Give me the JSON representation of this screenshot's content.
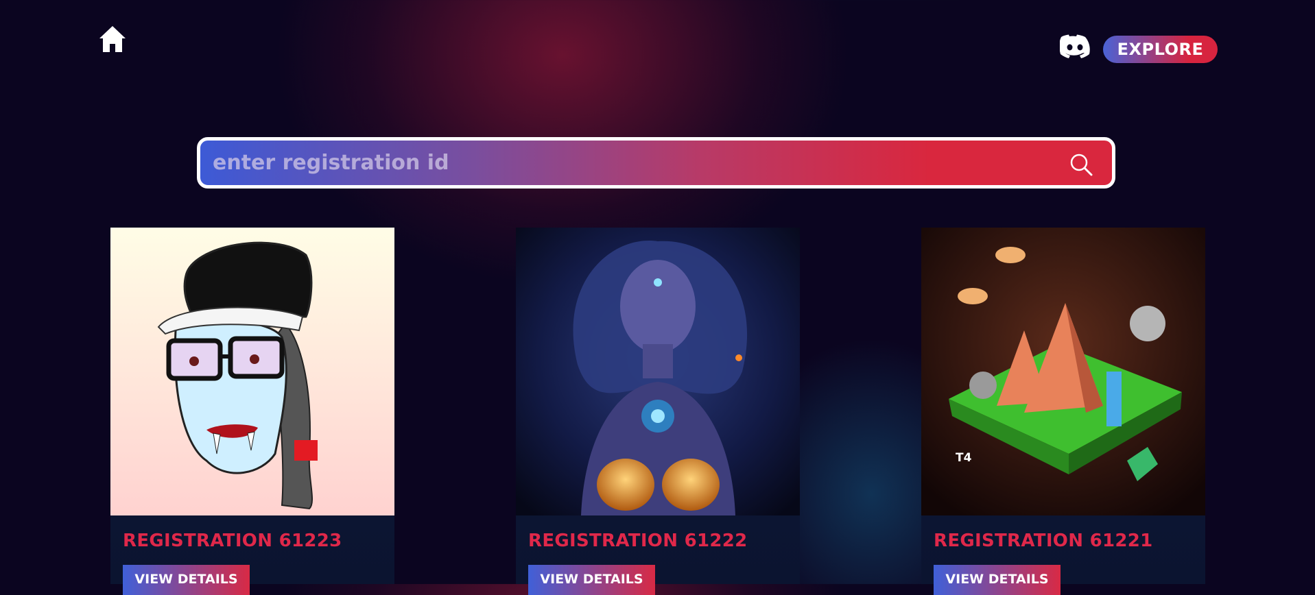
{
  "nav": {
    "home_icon": "home-icon",
    "discord_icon": "discord-icon",
    "explore_label": "EXPLORE"
  },
  "search": {
    "placeholder": "enter registration id",
    "value": "",
    "icon": "search-icon"
  },
  "cards": [
    {
      "title": "REGISTRATION 61223",
      "button_label": "VIEW DETAILS",
      "image": "gm-vampire-artwork"
    },
    {
      "title": "REGISTRATION 61222",
      "button_label": "VIEW DETAILS",
      "image": "cosmic-goddess-artwork"
    },
    {
      "title": "REGISTRATION 61221",
      "button_label": "VIEW DETAILS",
      "image": "pyramid-island-artwork",
      "image_text": "T4"
    }
  ],
  "colors": {
    "accent_blue": "#4060d8",
    "accent_red": "#d82a45",
    "title_red": "#e0284a",
    "background": "#0b0520"
  }
}
